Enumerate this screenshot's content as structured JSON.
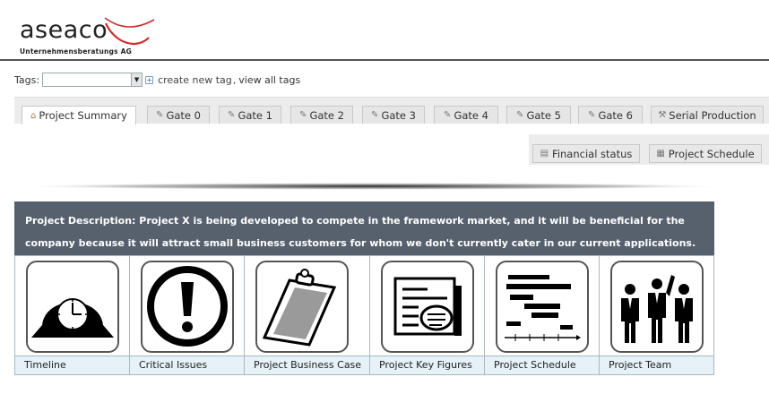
{
  "logo": {
    "name": "aseaco",
    "subtitle": "Unternehmensberatungs AG"
  },
  "tags": {
    "label": "Tags:",
    "selected": "",
    "create_link": "create new tag",
    "separator": ",",
    "view_link": "view all tags"
  },
  "tabs": [
    {
      "label": "Project Summary",
      "icon": "home-icon",
      "active": true
    },
    {
      "label": "Gate 0",
      "icon": "wrench-icon"
    },
    {
      "label": "Gate 1",
      "icon": "wrench-icon"
    },
    {
      "label": "Gate 2",
      "icon": "wrench-icon"
    },
    {
      "label": "Gate 3",
      "icon": "wrench-icon"
    },
    {
      "label": "Gate 4",
      "icon": "wrench-icon"
    },
    {
      "label": "Gate 5",
      "icon": "wrench-icon"
    },
    {
      "label": "Gate 6",
      "icon": "wrench-icon"
    },
    {
      "label": "Serial Production",
      "icon": "hammer-icon"
    }
  ],
  "subtabs": [
    {
      "label": "Financial status",
      "icon": "chart-icon"
    },
    {
      "label": "Project Schedule",
      "icon": "schedule-icon"
    }
  ],
  "description": {
    "line1": "Project Description: Project X is being developed to compete in the framework market, and it will be beneficial for the",
    "line2": "company because it will attract small business customers for whom we don't currently cater in our current applications."
  },
  "tiles": [
    {
      "label": "Timeline",
      "icon": "clock-icon"
    },
    {
      "label": "Critical Issues",
      "icon": "exclamation-icon"
    },
    {
      "label": "Project Business Case",
      "icon": "clipboard-icon"
    },
    {
      "label": "Project Key Figures",
      "icon": "report-icon"
    },
    {
      "label": "Project Schedule",
      "icon": "gantt-icon"
    },
    {
      "label": "Project Team",
      "icon": "team-icon"
    }
  ],
  "colors": {
    "description_bg": "#56616d",
    "caption_bg": "#e6f1f8",
    "swoosh": "#d42a2a"
  }
}
